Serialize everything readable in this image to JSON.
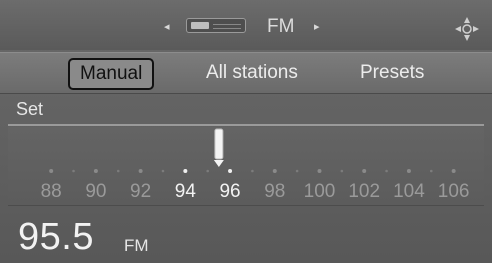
{
  "source": {
    "label": "FM",
    "prev_arrow": "◂",
    "next_arrow": "▸",
    "icon": "radio-icon"
  },
  "nav_icon": "navigation-compass-icon",
  "tabs": [
    {
      "label": "Manual",
      "selected": true
    },
    {
      "label": "All stations",
      "selected": false
    },
    {
      "label": "Presets",
      "selected": false
    }
  ],
  "set_label": "Set",
  "scale": {
    "labels": [
      "88",
      "90",
      "92",
      "94",
      "96",
      "98",
      "100",
      "102",
      "104",
      "106"
    ],
    "bright_labels": [
      "94",
      "96"
    ],
    "min": 87.5,
    "max": 107,
    "current": 95.5
  },
  "frequency": {
    "value": "95.5",
    "unit": "FM"
  },
  "colors": {
    "background": "#5e5e5e",
    "text": "#e8e8e8",
    "selected_border": "#111111"
  }
}
